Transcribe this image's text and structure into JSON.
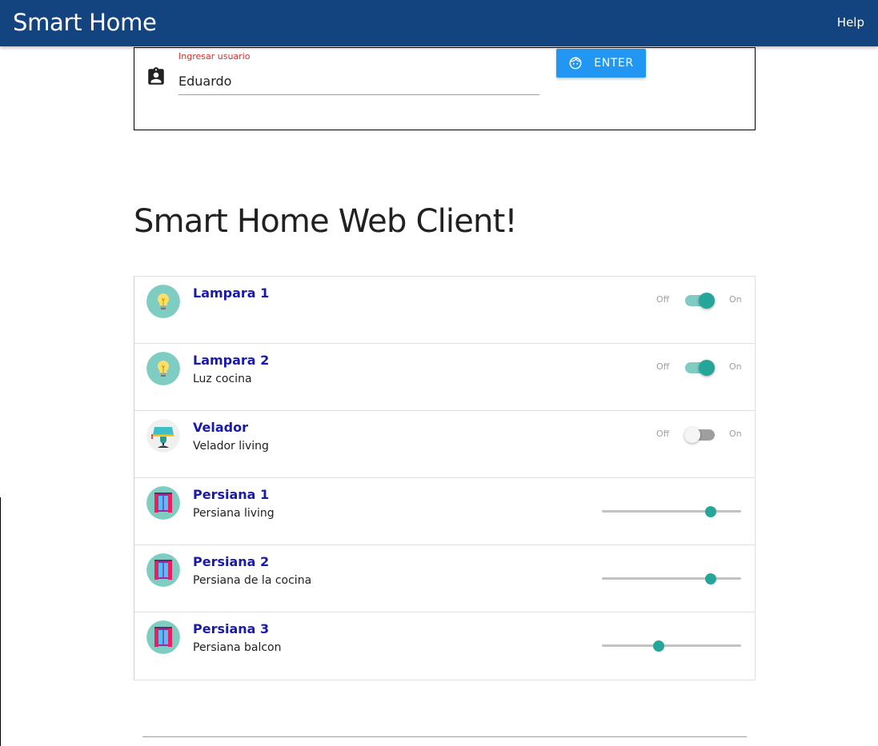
{
  "navbar": {
    "title": "Smart Home",
    "help_label": "Help",
    "background_color": "#13447f"
  },
  "login": {
    "label": "Ingresar usuario",
    "value": "Eduardo",
    "user_icon": "account-box-icon",
    "enter_label": "ENTER",
    "enter_icon": "face-icon",
    "enter_color": "#2196f3",
    "label_color": "#d32f2f"
  },
  "page_title": "Smart Home Web Client!",
  "devices": [
    {
      "name": "Lampara 1",
      "description": "",
      "icon": "lightbulb-icon",
      "control": "switch",
      "state": "on",
      "off_label": "Off",
      "on_label": "On"
    },
    {
      "name": "Lampara 2",
      "description": "Luz cocina",
      "icon": "lightbulb-icon",
      "control": "switch",
      "state": "on",
      "off_label": "Off",
      "on_label": "On"
    },
    {
      "name": "Velador",
      "description": "Velador living",
      "icon": "lamp-icon",
      "control": "switch",
      "state": "off",
      "off_label": "Off",
      "on_label": "On"
    },
    {
      "name": "Persiana 1",
      "description": "Persiana living",
      "icon": "window-blind-icon",
      "control": "slider",
      "level": 0.78
    },
    {
      "name": "Persiana 2",
      "description": "Persiana de la cocina",
      "icon": "window-blind-icon",
      "control": "slider",
      "level": 0.78
    },
    {
      "name": "Persiana 3",
      "description": "Persiana balcon",
      "icon": "window-blind-icon",
      "control": "slider",
      "level": 0.41
    }
  ],
  "colors": {
    "accent": "#26a69a",
    "device_name": "#1a1aaa"
  }
}
